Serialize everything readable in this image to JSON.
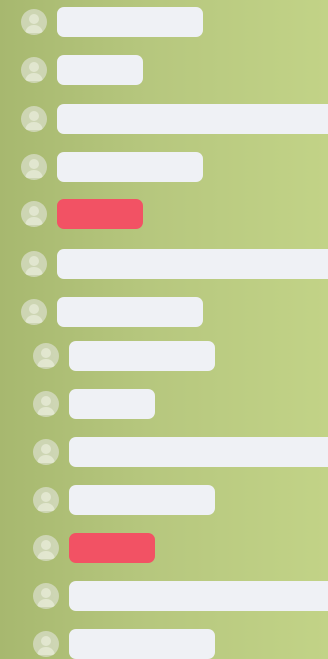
{
  "messages": [
    {
      "id": 1,
      "kind": "normal",
      "text": ""
    },
    {
      "id": 2,
      "kind": "normal",
      "text": ""
    },
    {
      "id": 3,
      "kind": "normal",
      "text": ""
    },
    {
      "id": 4,
      "kind": "normal",
      "text": ""
    },
    {
      "id": 5,
      "kind": "accent",
      "text": ""
    },
    {
      "id": 6,
      "kind": "normal",
      "text": ""
    },
    {
      "id": 7,
      "kind": "normal",
      "text": ""
    },
    {
      "id": 8,
      "kind": "normal",
      "text": ""
    },
    {
      "id": 9,
      "kind": "normal",
      "text": ""
    },
    {
      "id": 10,
      "kind": "normal",
      "text": ""
    },
    {
      "id": 11,
      "kind": "normal",
      "text": ""
    },
    {
      "id": 12,
      "kind": "accent",
      "text": ""
    },
    {
      "id": 13,
      "kind": "normal",
      "text": ""
    },
    {
      "id": 14,
      "kind": "normal",
      "text": ""
    }
  ],
  "colors": {
    "bubble": "#eff1f5",
    "accent_bubble": "#f25264",
    "background": "#b6c77e"
  },
  "icons": {
    "avatar": "user-avatar-icon"
  }
}
